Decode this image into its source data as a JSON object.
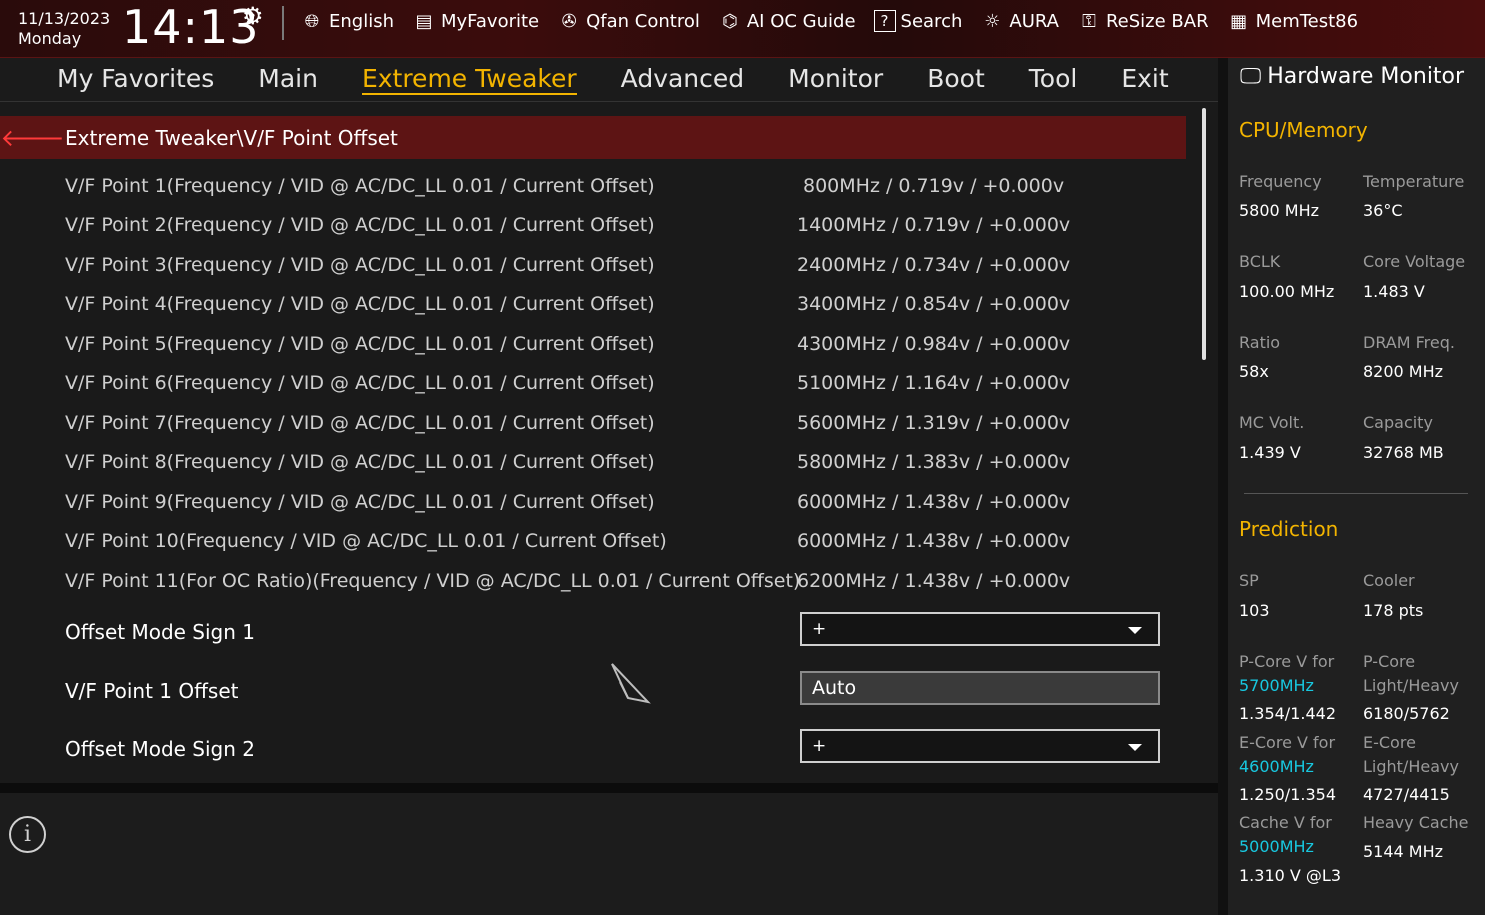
{
  "topbar": {
    "date": "11/13/2023",
    "day": "Monday",
    "time": "14:13",
    "nav": [
      {
        "label": "English",
        "icon": "globe-icon"
      },
      {
        "label": "MyFavorite",
        "icon": "favorite-icon"
      },
      {
        "label": "Qfan Control",
        "icon": "fan-icon"
      },
      {
        "label": "AI OC Guide",
        "icon": "ai-chip-icon"
      },
      {
        "label": "Search",
        "icon": "question-box-icon"
      },
      {
        "label": "AURA",
        "icon": "aura-light-icon"
      },
      {
        "label": "ReSize BAR",
        "icon": "resize-bar-icon"
      },
      {
        "label": "MemTest86",
        "icon": "memory-icon"
      }
    ]
  },
  "tabs": [
    "My Favorites",
    "Main",
    "Extreme Tweaker",
    "Advanced",
    "Monitor",
    "Boot",
    "Tool",
    "Exit"
  ],
  "breadcrumb": "Extreme Tweaker\\V/F Point Offset",
  "vf_points": [
    {
      "label": "V/F Point 1(Frequency / VID @ AC/DC_LL 0.01 / Current Offset)",
      "value": "800MHz / 0.719v / +0.000v"
    },
    {
      "label": "V/F Point 2(Frequency / VID @ AC/DC_LL 0.01 / Current Offset)",
      "value": "1400MHz / 0.719v / +0.000v"
    },
    {
      "label": "V/F Point 3(Frequency / VID @ AC/DC_LL 0.01 / Current Offset)",
      "value": "2400MHz / 0.734v / +0.000v"
    },
    {
      "label": "V/F Point 4(Frequency / VID @ AC/DC_LL 0.01 / Current Offset)",
      "value": "3400MHz / 0.854v / +0.000v"
    },
    {
      "label": "V/F Point 5(Frequency / VID @ AC/DC_LL 0.01 / Current Offset)",
      "value": "4300MHz / 0.984v / +0.000v"
    },
    {
      "label": "V/F Point 6(Frequency / VID @ AC/DC_LL 0.01 / Current Offset)",
      "value": "5100MHz / 1.164v / +0.000v"
    },
    {
      "label": "V/F Point 7(Frequency / VID @ AC/DC_LL 0.01 / Current Offset)",
      "value": "5600MHz / 1.319v / +0.000v"
    },
    {
      "label": "V/F Point 8(Frequency / VID @ AC/DC_LL 0.01 / Current Offset)",
      "value": "5800MHz / 1.383v / +0.000v"
    },
    {
      "label": "V/F Point 9(Frequency / VID @ AC/DC_LL 0.01 / Current Offset)",
      "value": "6000MHz / 1.438v / +0.000v"
    },
    {
      "label": "V/F Point 10(Frequency / VID @ AC/DC_LL 0.01 / Current Offset)",
      "value": "6000MHz / 1.438v / +0.000v"
    },
    {
      "label": "V/F Point 11(For OC Ratio)(Frequency / VID @ AC/DC_LL 0.01 / Current Offset)",
      "value": "6200MHz / 1.438v / +0.000v"
    }
  ],
  "controls": {
    "sign1_label": "Offset Mode Sign 1",
    "sign1_value": "+",
    "offset1_label": "V/F Point 1 Offset",
    "offset1_value": "Auto",
    "sign2_label": "Offset Mode Sign 2",
    "sign2_value": "+"
  },
  "hw": {
    "title": "Hardware Monitor",
    "cpu_mem": "CPU/Memory",
    "frequency_k": "Frequency",
    "frequency_v": "5800 MHz",
    "temperature_k": "Temperature",
    "temperature_v": "36°C",
    "bclk_k": "BCLK",
    "bclk_v": "100.00 MHz",
    "core_voltage_k": "Core Voltage",
    "core_voltage_v": "1.483 V",
    "ratio_k": "Ratio",
    "ratio_v": "58x",
    "dram_freq_k": "DRAM Freq.",
    "dram_freq_v": "8200 MHz",
    "mc_volt_k": "MC Volt.",
    "mc_volt_v": "1.439 V",
    "capacity_k": "Capacity",
    "capacity_v": "32768 MB",
    "prediction": "Prediction",
    "sp_k": "SP",
    "sp_v": "103",
    "cooler_k": "Cooler",
    "cooler_v": "178 pts",
    "pcore_v_k": "P-Core V for",
    "pcore_v_freq": "5700MHz",
    "pcore_v_v": "1.354/1.442",
    "pcore_lh_k1": "P-Core",
    "pcore_lh_k2": "Light/Heavy",
    "pcore_lh_v": "6180/5762",
    "ecore_v_k": "E-Core V for",
    "ecore_v_freq": "4600MHz",
    "ecore_v_v": "1.250/1.354",
    "ecore_lh_k1": "E-Core",
    "ecore_lh_k2": "Light/Heavy",
    "ecore_lh_v": "4727/4415",
    "cache_v_k": "Cache V for",
    "cache_v_freq": "5000MHz",
    "cache_v_v": "1.310 V @L3",
    "heavy_cache_k": "Heavy Cache",
    "heavy_cache_v": "5144 MHz"
  }
}
